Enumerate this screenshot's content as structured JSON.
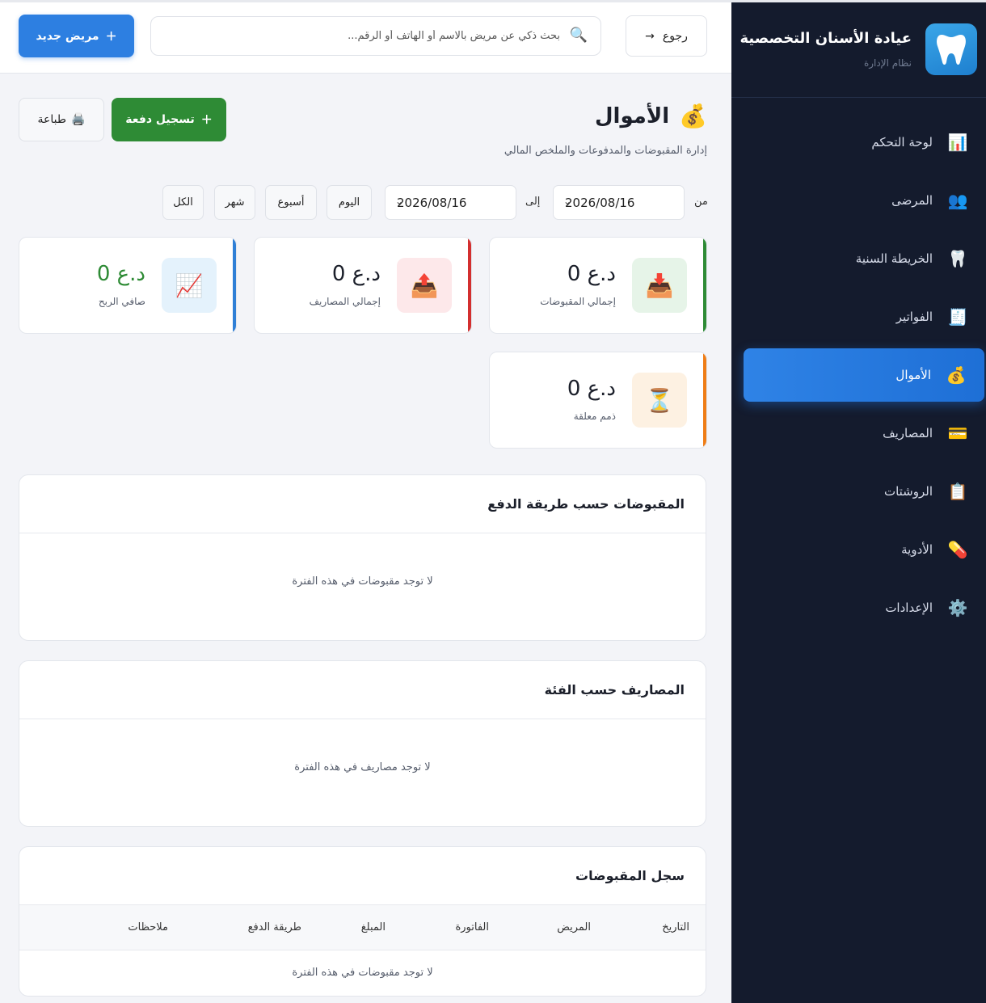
{
  "sidebar": {
    "brand_title": "عيادة الأسنان التخصصية",
    "brand_subtitle": "نظام الإدارة",
    "items": [
      {
        "label": "لوحة التحكم",
        "icon": "📊",
        "icon_name": "chart-icon"
      },
      {
        "label": "المرضى",
        "icon": "👥",
        "icon_name": "users-icon"
      },
      {
        "label": "الخريطة السنية",
        "icon": "🦷",
        "icon_name": "tooth-icon"
      },
      {
        "label": "الفواتير",
        "icon": "🧾",
        "icon_name": "receipt-icon"
      },
      {
        "label": "الأموال",
        "icon": "💰",
        "icon_name": "money-bag-icon"
      },
      {
        "label": "المصاريف",
        "icon": "💳",
        "icon_name": "credit-card-icon"
      },
      {
        "label": "الروشتات",
        "icon": "📋",
        "icon_name": "clipboard-icon"
      },
      {
        "label": "الأدوية",
        "icon": "💊",
        "icon_name": "pill-icon"
      },
      {
        "label": "الإعدادات",
        "icon": "⚙️",
        "icon_name": "gear-icon"
      }
    ],
    "active_index": 4
  },
  "topbar": {
    "new_patient": "مريض جديد",
    "search_placeholder": "بحث ذكي عن مريض بالاسم أو الهاتف أو الرقم...",
    "back": "رجوع"
  },
  "page": {
    "title": "الأموال",
    "subtitle": "إدارة المقبوضات والمدفوعات والملخص المالي",
    "record_payment": "تسجيل دفعة",
    "print": "طباعة"
  },
  "filters": {
    "from_label": "من",
    "to_label": "إلى",
    "from_date": "2026/08/16",
    "to_date": "2026/08/16",
    "today": "اليوم",
    "week": "أسبوع",
    "month": "شهر",
    "all": "الكل"
  },
  "stats": [
    {
      "value": "0 د.ع",
      "label": "إجمالي المقبوضات",
      "icon": "📥",
      "accent": "#2e8b35",
      "icon_bg": "#e6f4e8"
    },
    {
      "value": "0 د.ع",
      "label": "إجمالي المصاريف",
      "icon": "📤",
      "accent": "#d32f2f",
      "icon_bg": "#fde8ea"
    },
    {
      "value": "0 د.ع",
      "label": "صافي الربح",
      "icon": "📈",
      "accent": "#2f7fd6",
      "icon_bg": "#e4f2fc",
      "value_color": "#2e8b35"
    },
    {
      "value": "0 د.ع",
      "label": "ذمم معلقة",
      "icon": "⏳",
      "accent": "#ef7d16",
      "icon_bg": "#fdf1e2"
    }
  ],
  "panels": {
    "by_method": {
      "title": "المقبوضات حسب طريقة الدفع",
      "empty": "لا توجد مقبوضات في هذه الفترة"
    },
    "by_category": {
      "title": "المصاريف حسب الفئة",
      "empty": "لا توجد مصاريف في هذه الفترة"
    },
    "log": {
      "title": "سجل المقبوضات",
      "columns": [
        "التاريخ",
        "المريض",
        "الفاتورة",
        "المبلغ",
        "طريقة الدفع",
        "ملاحظات"
      ],
      "empty": "لا توجد مقبوضات في هذه الفترة"
    }
  },
  "colors": {
    "sidebar_bg": "#141b2d",
    "primary": "#2d7fe1",
    "success": "#2e8b35"
  }
}
